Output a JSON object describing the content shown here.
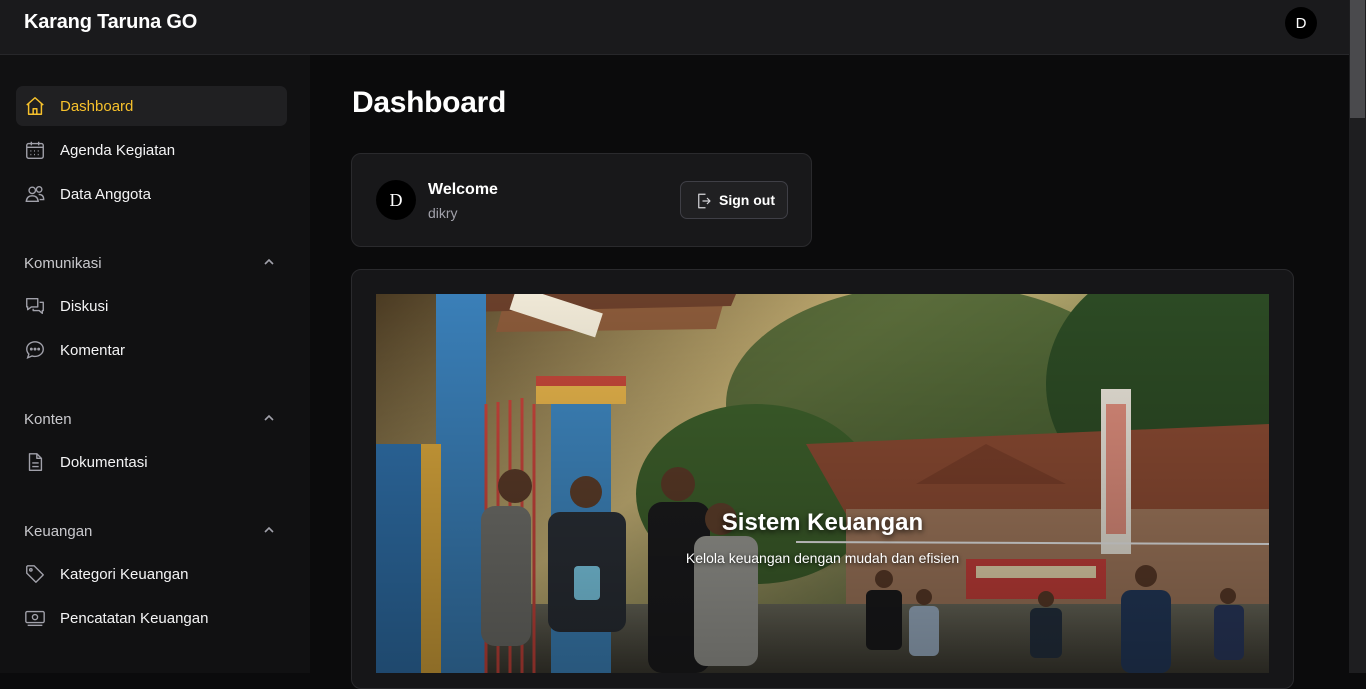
{
  "app": {
    "title": "Karang Taruna GO",
    "avatar_initial": "D"
  },
  "sidebar": {
    "items": [
      {
        "label": "Dashboard",
        "icon": "home-icon",
        "active": true
      },
      {
        "label": "Agenda Kegiatan",
        "icon": "calendar-icon"
      },
      {
        "label": "Data Anggota",
        "icon": "users-icon"
      }
    ],
    "sections": [
      {
        "label": "Komunikasi",
        "items": [
          {
            "label": "Diskusi",
            "icon": "chat-bubbles-icon"
          },
          {
            "label": "Komentar",
            "icon": "comment-icon"
          }
        ]
      },
      {
        "label": "Konten",
        "items": [
          {
            "label": "Dokumentasi",
            "icon": "document-icon"
          }
        ]
      },
      {
        "label": "Keuangan",
        "items": [
          {
            "label": "Kategori Keuangan",
            "icon": "tag-icon"
          },
          {
            "label": "Pencatatan Keuangan",
            "icon": "money-icon"
          }
        ]
      }
    ]
  },
  "main": {
    "page_title": "Dashboard",
    "welcome": {
      "avatar_initial": "D",
      "title": "Welcome",
      "username": "dikry",
      "sign_out_label": "Sign out"
    },
    "banner": {
      "title": "Sistem Keuangan",
      "subtitle": "Kelola keuangan dengan mudah dan efisien"
    }
  },
  "colors": {
    "accent": "#f6c12c",
    "background": "#0b0b0c",
    "card": "#18181a"
  }
}
